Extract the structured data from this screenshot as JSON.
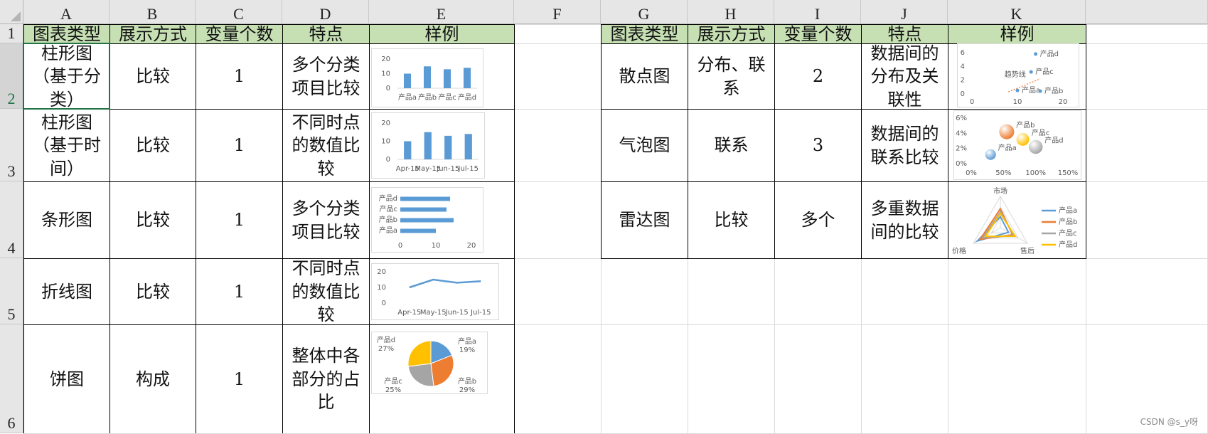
{
  "sheet": {
    "columns": [
      "A",
      "B",
      "C",
      "D",
      "E",
      "F",
      "G",
      "H",
      "I",
      "J",
      "K"
    ],
    "rows": [
      "1",
      "2",
      "3",
      "4",
      "5",
      "6"
    ],
    "left_table": {
      "headers": [
        "图表类型",
        "展示方式",
        "变量个数",
        "特点",
        "样例"
      ],
      "rows": [
        {
          "type": "柱形图（基于分类）",
          "mode": "比较",
          "vars": "1",
          "feature": "多个分类项目比较"
        },
        {
          "type": "柱形图（基于时间）",
          "mode": "比较",
          "vars": "1",
          "feature": "不同时点的数值比较"
        },
        {
          "type": "条形图",
          "mode": "比较",
          "vars": "1",
          "feature": "多个分类项目比较"
        },
        {
          "type": "折线图",
          "mode": "比较",
          "vars": "1",
          "feature": "不同时点的数值比较"
        },
        {
          "type": "饼图",
          "mode": "构成",
          "vars": "1",
          "feature": "整体中各部分的占比"
        }
      ]
    },
    "right_table": {
      "headers": [
        "图表类型",
        "展示方式",
        "变量个数",
        "特点",
        "样例"
      ],
      "rows": [
        {
          "type": "散点图",
          "mode": "分布、联系",
          "vars": "2",
          "feature": "数据间的分布及关联性"
        },
        {
          "type": "气泡图",
          "mode": "联系",
          "vars": "3",
          "feature": "数据间的联系比较"
        },
        {
          "type": "雷达图",
          "mode": "比较",
          "vars": "多个",
          "feature": "多重数据间的比较"
        }
      ]
    },
    "watermark": "CSDN @s_y呀"
  },
  "chart_data": [
    {
      "type": "bar",
      "name": "column-by-category",
      "categories": [
        "产品a",
        "产品b",
        "产品c",
        "产品d"
      ],
      "values": [
        10,
        15,
        13,
        14
      ],
      "ylim": [
        0,
        20
      ],
      "yticks": [
        0,
        10,
        20
      ],
      "color": "#5b9bd5"
    },
    {
      "type": "bar",
      "name": "column-by-time",
      "categories": [
        "Apr-15",
        "May-15",
        "Jun-15",
        "Jul-15"
      ],
      "values": [
        10,
        15,
        13,
        14
      ],
      "ylim": [
        0,
        20
      ],
      "yticks": [
        0,
        10,
        20
      ],
      "color": "#5b9bd5"
    },
    {
      "type": "bar",
      "orientation": "horizontal",
      "name": "bar-horizontal",
      "categories": [
        "产品a",
        "产品b",
        "产品c",
        "产品d"
      ],
      "values": [
        10,
        15,
        13,
        14
      ],
      "xlim": [
        0,
        20
      ],
      "xticks": [
        0,
        10,
        20
      ],
      "color": "#5b9bd5"
    },
    {
      "type": "line",
      "name": "line-by-time",
      "categories": [
        "Apr-15",
        "May-15",
        "Jun-15",
        "Jul-15"
      ],
      "values": [
        10,
        15,
        13,
        14
      ],
      "ylim": [
        0,
        20
      ],
      "yticks": [
        0,
        10,
        20
      ],
      "color": "#5b9bd5"
    },
    {
      "type": "pie",
      "name": "pie-composition",
      "slices": [
        {
          "label": "产品a",
          "value": 19,
          "pct": "19%",
          "color": "#5b9bd5"
        },
        {
          "label": "产品b",
          "value": 29,
          "pct": "29%",
          "color": "#ed7d31"
        },
        {
          "label": "产品c",
          "value": 25,
          "pct": "25%",
          "color": "#a5a5a5"
        },
        {
          "label": "产品d",
          "value": 27,
          "pct": "27%",
          "color": "#ffc000"
        }
      ]
    },
    {
      "type": "scatter",
      "name": "scatter-distribution",
      "points": [
        {
          "label": "产品a",
          "x": 10,
          "y": 0.5
        },
        {
          "label": "产品b",
          "x": 15,
          "y": 0.4
        },
        {
          "label": "产品c",
          "x": 13,
          "y": 3.2
        },
        {
          "label": "产品d",
          "x": 14,
          "y": 5.8
        }
      ],
      "xlim": [
        0,
        20
      ],
      "ylim": [
        0,
        6
      ],
      "xticks": [
        0,
        10,
        20
      ],
      "yticks": [
        0,
        2,
        4,
        6
      ],
      "trend_label": "趋势线",
      "color": "#5b9bd5",
      "trend_color": "#ed7d31"
    },
    {
      "type": "scatter",
      "subtype": "bubble",
      "name": "bubble-relation",
      "points": [
        {
          "label": "产品a",
          "x": 0.3,
          "y": 0.012,
          "size": 10,
          "color": "#5b9bd5"
        },
        {
          "label": "产品b",
          "x": 0.55,
          "y": 0.042,
          "size": 14,
          "color": "#ed7d31"
        },
        {
          "label": "产品c",
          "x": 0.8,
          "y": 0.032,
          "size": 12,
          "color": "#ffc000"
        },
        {
          "label": "产品d",
          "x": 1.0,
          "y": 0.022,
          "size": 13,
          "color": "#a5a5a5"
        }
      ],
      "xlim": [
        0,
        1.5
      ],
      "ylim": [
        0,
        0.06
      ],
      "xticks": [
        "0%",
        "50%",
        "100%",
        "150%"
      ],
      "yticks": [
        "0%",
        "2%",
        "4%",
        "6%"
      ]
    },
    {
      "type": "radar",
      "name": "radar-compare",
      "axes": [
        "市场",
        "价格",
        "售后"
      ],
      "series": [
        {
          "name": "产品a",
          "color": "#5b9bd5",
          "values": [
            0.35,
            0.85,
            0.3
          ]
        },
        {
          "name": "产品b",
          "color": "#ed7d31",
          "values": [
            0.6,
            0.75,
            0.45
          ]
        },
        {
          "name": "产品c",
          "color": "#a5a5a5",
          "values": [
            0.5,
            0.65,
            0.5
          ]
        },
        {
          "name": "产品d",
          "color": "#ffc000",
          "values": [
            0.45,
            0.55,
            0.55
          ]
        }
      ]
    }
  ]
}
